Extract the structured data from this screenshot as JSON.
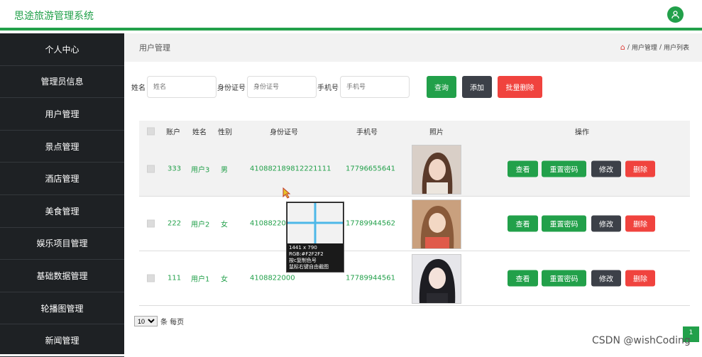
{
  "app": {
    "title": "思途旅游管理系统"
  },
  "sidebar": {
    "items": [
      {
        "label": "个人中心"
      },
      {
        "label": "管理员信息"
      },
      {
        "label": "用户管理"
      },
      {
        "label": "景点管理"
      },
      {
        "label": "酒店管理"
      },
      {
        "label": "美食管理"
      },
      {
        "label": "娱乐项目管理"
      },
      {
        "label": "基础数据管理"
      },
      {
        "label": "轮播图管理"
      },
      {
        "label": "新闻管理"
      }
    ]
  },
  "breadcrumb": {
    "page_title": "用户管理",
    "sep": "/",
    "level1": "用户管理",
    "level2": "用户列表"
  },
  "search": {
    "name_label": "姓名",
    "name_placeholder": "姓名",
    "id_label": "身份证号",
    "id_placeholder": "身份证号",
    "phone_label": "手机号",
    "phone_placeholder": "手机号",
    "query_label": "查询",
    "add_label": "添加",
    "bulk_delete_label": "批量删除"
  },
  "table": {
    "headers": {
      "account": "账户",
      "name": "姓名",
      "gender": "性别",
      "id_card": "身份证号",
      "phone": "手机号",
      "photo": "照片",
      "actions": "操作"
    },
    "rows": [
      {
        "account": "333",
        "name": "用户3",
        "gender": "男",
        "id_card": "410882189812221111",
        "phone": "17796655641"
      },
      {
        "account": "222",
        "name": "用户2",
        "gender": "女",
        "id_card": "4108822000",
        "phone": "17789944562"
      },
      {
        "account": "111",
        "name": "用户1",
        "gender": "女",
        "id_card": "4108822000",
        "phone": "17789944561"
      }
    ],
    "actions": {
      "view": "查看",
      "reset": "重置密码",
      "edit": "修改",
      "delete": "删除"
    }
  },
  "pager": {
    "page_size": "10",
    "suffix": "条 每页",
    "current_page": "1"
  },
  "picker": {
    "size": "1441 x 790",
    "rgb": "RGB:#F2F2F2",
    "hint1": "按c复制色号",
    "hint2": "鼠标右键自由截图"
  },
  "watermark": "CSDN @wishCoding",
  "colors": {
    "accent": "#22a04a",
    "dark_button": "#3c4048",
    "danger": "#f0433e",
    "sidebar_bg": "#1e2124"
  }
}
